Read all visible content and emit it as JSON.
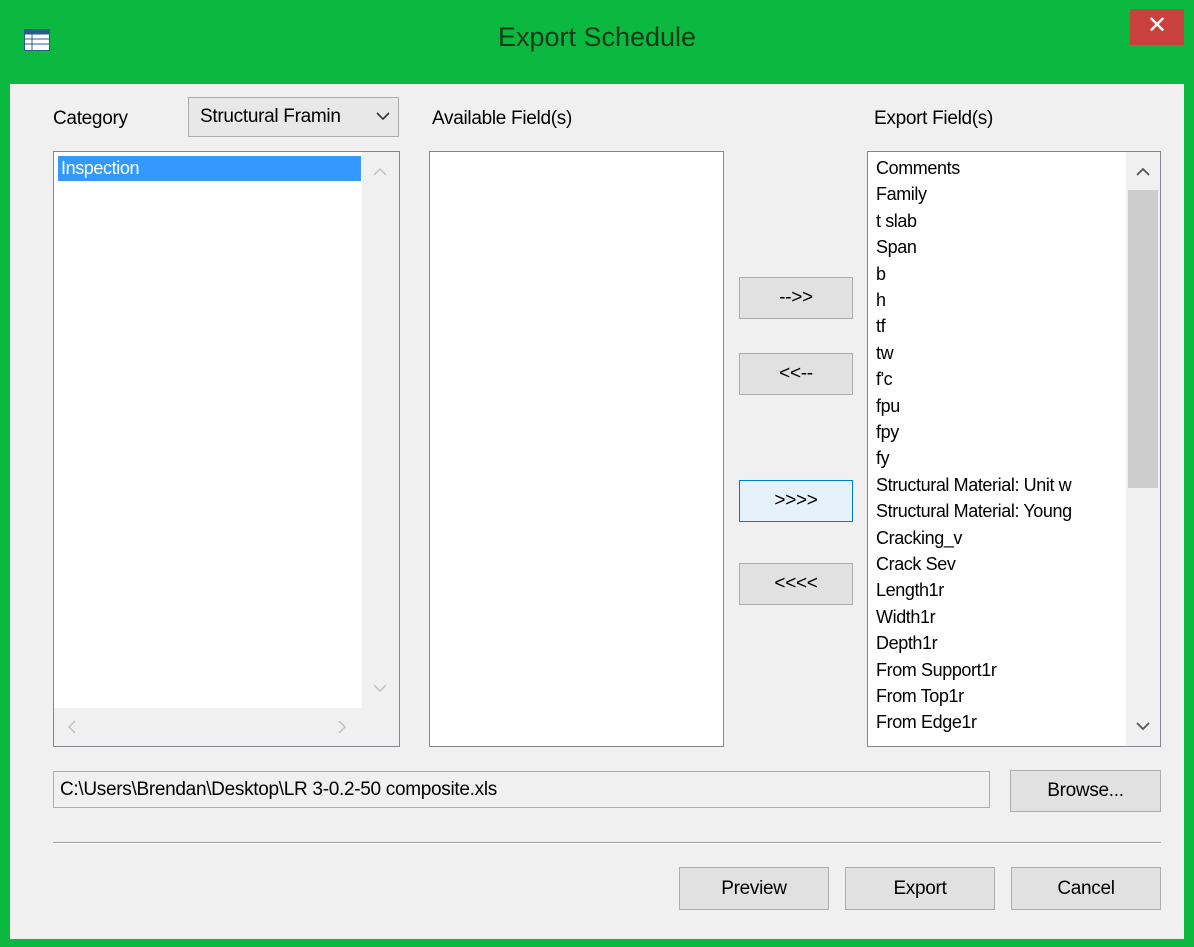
{
  "window": {
    "title": "Export Schedule",
    "close_label": "✕",
    "frame_color": "#0cb940"
  },
  "category": {
    "label": "Category",
    "selected": "Structural Framin",
    "items": [
      "Inspection"
    ]
  },
  "available": {
    "label": "Available Field(s)",
    "items": []
  },
  "export_fields": {
    "label": "Export Field(s)",
    "items": [
      "Comments",
      "Family",
      "t slab",
      "Span",
      "b",
      "h",
      "tf",
      "tw",
      "f'c",
      "fpu",
      "fpy",
      "fy",
      "Structural Material: Unit w",
      "Structural Material: Young",
      "Cracking_v",
      "Crack Sev",
      "Length1r",
      "Width1r",
      "Depth1r",
      "From Support1r",
      "From Top1r",
      "From Edge1r"
    ]
  },
  "transfer_buttons": {
    "add": "-->>",
    "remove": "<<--",
    "add_all": ">>>>",
    "remove_all": "<<<<"
  },
  "file": {
    "path": "C:\\Users\\Brendan\\Desktop\\LR 3-0.2-50 composite.xls",
    "browse": "Browse..."
  },
  "footer": {
    "preview": "Preview",
    "export": "Export",
    "cancel": "Cancel"
  },
  "icons": {
    "app": "table-icon",
    "close": "close-icon",
    "combo": "chevron-down-icon"
  }
}
